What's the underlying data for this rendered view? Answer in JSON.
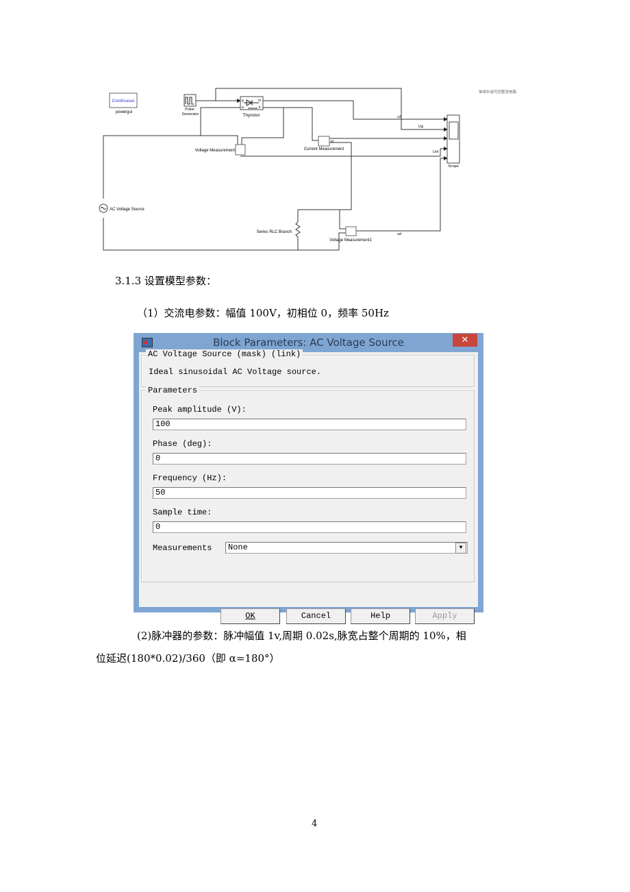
{
  "diagram": {
    "title": "单相半波可控整流电路",
    "powergui_block": "Continuous",
    "powergui_label": "powergui",
    "pulse_label_1": "Pulse",
    "pulse_label_2": "Generator",
    "thyristor_label": "Thyristor",
    "thyristor_ports": {
      "g": "g",
      "a": "a",
      "m": "m",
      "k": "k"
    },
    "voltage_measurement_label": "Voltage Measurement",
    "current_measurement_label": "Current Measurement",
    "ac_source_label": "AC Voltage Source",
    "rlc_label": "Series RLC Branch",
    "voltage_measurement1_label": "Voltage Measurement1",
    "scope_label": "Scope",
    "signals": {
      "u2": "u2",
      "ug": "Ug",
      "id": "id",
      "uvt": "Uvt",
      "ud": "ud"
    }
  },
  "section_heading": "3.1.3 设置模型参数：",
  "para1": "（1）交流电参数：幅值 100V，初相位 0，频率 50Hz",
  "dialog": {
    "title": "Block Parameters: AC Voltage Source",
    "close": "✕",
    "mask_group": "AC Voltage Source (mask) (link)",
    "description": "Ideal sinusoidal AC Voltage source.",
    "params_group": "Parameters",
    "fields": [
      {
        "label": "Peak amplitude (V):",
        "value": "100"
      },
      {
        "label": "Phase (deg):",
        "value": "0"
      },
      {
        "label": "Frequency (Hz):",
        "value": "50"
      },
      {
        "label": "Sample time:",
        "value": "0"
      }
    ],
    "measurements_label": "Measurements",
    "measurements_value": "None",
    "buttons": {
      "ok": "OK",
      "cancel": "Cancel",
      "help": "Help",
      "apply": "Apply"
    }
  },
  "para2_line1": "(2)脉冲器的参数：脉冲幅值 1v,周期 0.02s,脉宽占整个周期的 10%，相",
  "para2_line2": "位延迟(180*0.02)/360（即 α=180°）",
  "page_number": "4"
}
